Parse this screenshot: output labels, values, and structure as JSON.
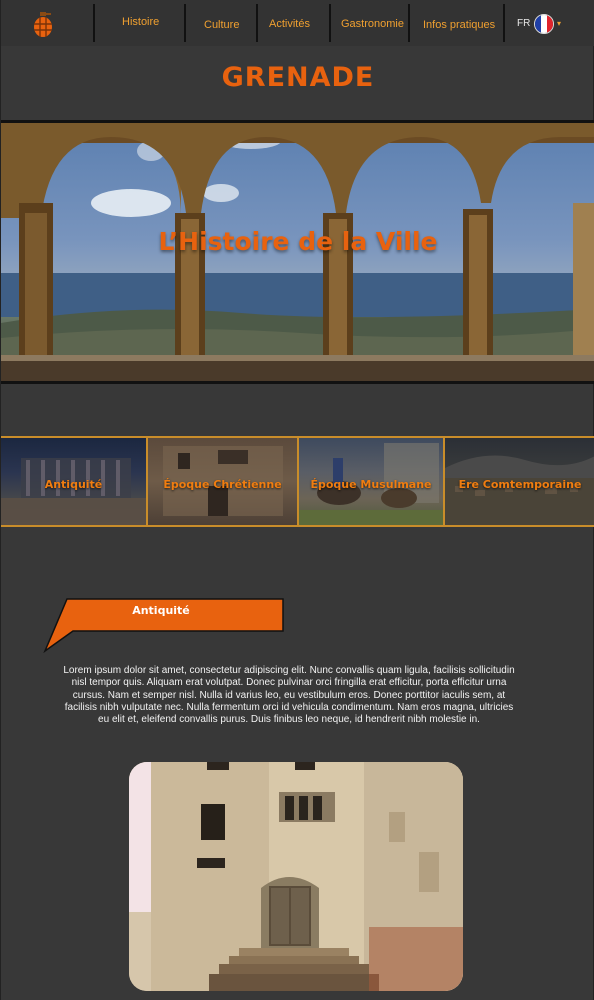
{
  "nav": {
    "items": [
      {
        "label": "Histoire",
        "active": true
      },
      {
        "label": "Culture"
      },
      {
        "label": "Activités"
      },
      {
        "label": "Gastronomie"
      },
      {
        "label": "Infos pratiques"
      }
    ],
    "language": "FR",
    "flag_colors": [
      "#1f3fa8",
      "#ffffff",
      "#e0242c"
    ],
    "logo_icon": "grenade-icon",
    "chevron_icon": "chevron-down-icon"
  },
  "site": {
    "title": "GRENADE"
  },
  "hero": {
    "title": "L’Histoire de la Ville"
  },
  "periods": [
    {
      "label": "Antiquité"
    },
    {
      "label": "Époque Chrétienne"
    },
    {
      "label": "Époque Musulmane"
    },
    {
      "label": "Ere Comtemporaine"
    }
  ],
  "section": {
    "title": "Antiquité",
    "text": "Lorem ipsum dolor sit amet, consectetur adipiscing elit. Nunc convallis quam ligula, facilisis sollicitudin nisl tempor quis. Aliquam erat volutpat. Donec pulvinar orci fringilla erat efficitur, porta efficitur urna cursus. Nam et semper nisl. Nulla id varius leo, eu vestibulum eros. Donec porttitor iaculis sem, at facilisis nibh vulputate nec. Nulla fermentum orci id vehicula condimentum. Nam eros magna, ultricies eu elit et, eleifend convallis purus. Duis finibus leo neque, id hendrerit nibh molestie in."
  },
  "colors": {
    "accent": "#e8620f",
    "nav_text": "#f0a030",
    "gold_border": "#c98d2a",
    "background": "#383838"
  }
}
